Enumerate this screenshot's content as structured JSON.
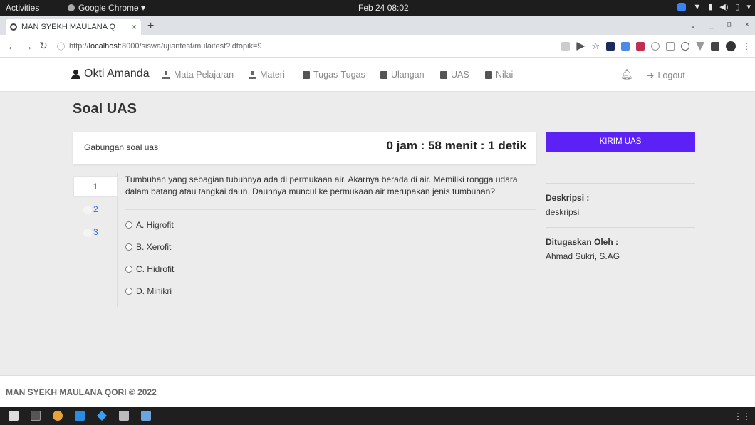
{
  "system": {
    "activities": "Activities",
    "app_name": "Google Chrome ▾",
    "clock": "Feb 24  08:02"
  },
  "browser": {
    "tab_title": "MAN SYEKH MAULANA Q",
    "url_prefix": "http://",
    "url_host": "localhost",
    "url_path": ":8000/siswa/ujiantest/mulaitest?idtopik=9"
  },
  "nav": {
    "user_name": "Okti Amanda",
    "items": [
      "Mata Pelajaran",
      "Materi",
      "Tugas-Tugas",
      "Ulangan",
      "UAS",
      "Nilai"
    ],
    "logout": "Logout"
  },
  "page": {
    "title": "Soal UAS",
    "exam_label": "Gabungan soal uas",
    "timer": "0 jam : 58 menit : 1 detik",
    "submit_label": "KIRIM UAS"
  },
  "questions_nav": [
    "1",
    "2",
    "3"
  ],
  "question": {
    "text": "Tumbuhan yang sebagian tubuhnya ada di permukaan air. Akarnya berada di air. Memiliki rongga udara dalam batang atau tangkai daun. Daunnya muncul ke permukaan air merupakan jenis tumbuhan?",
    "options": [
      "A. Higrofit",
      "B. Xerofit",
      "C. Hidrofit",
      "D. Minikri"
    ]
  },
  "sidebar": {
    "desc_label": "Deskripsi :",
    "desc_value": "deskripsi",
    "assigned_label": "Ditugaskan Oleh :",
    "assigned_value": "Ahmad Sukri, S.AG"
  },
  "footer": {
    "text": "MAN SYEKH MAULANA QORI © 2022"
  },
  "colors": {
    "accent": "#5b21f5",
    "topbar": "#1d1d1d"
  }
}
